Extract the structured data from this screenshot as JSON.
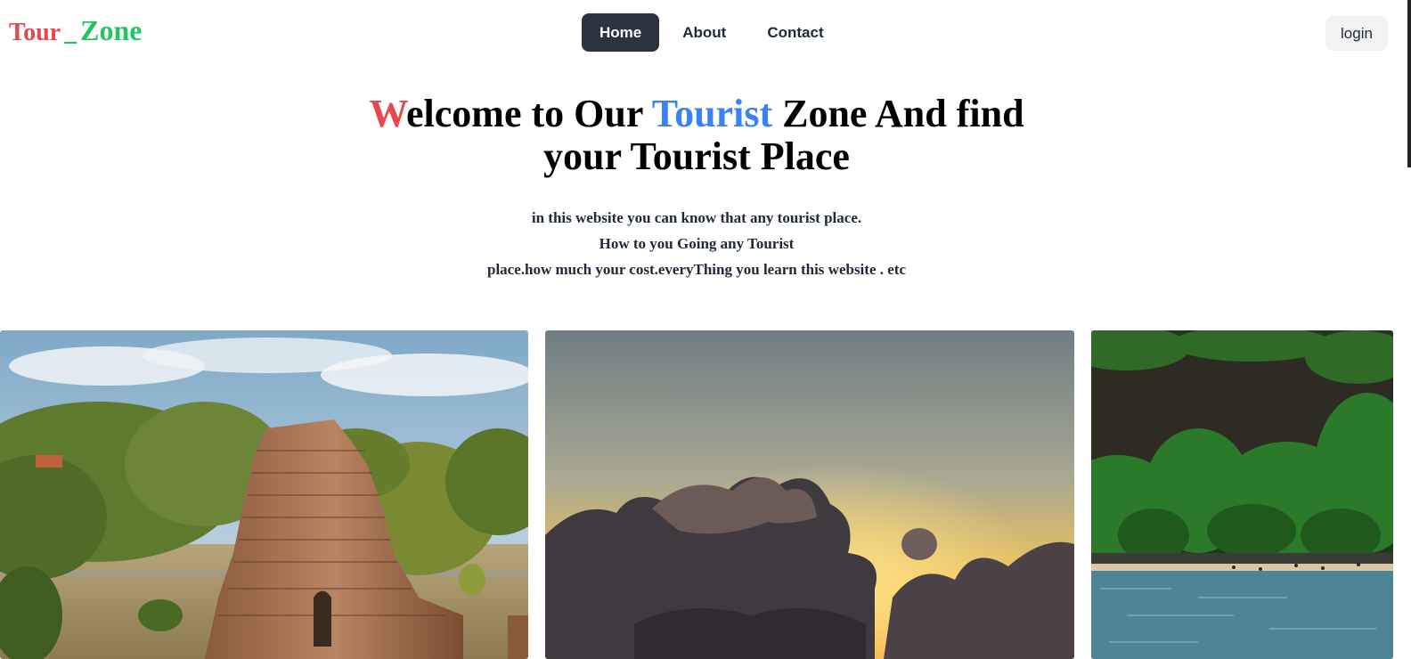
{
  "logo": {
    "part1": "Tour",
    "separator": "_",
    "part2": "Zone"
  },
  "nav": {
    "items": [
      {
        "label": "Home",
        "active": true
      },
      {
        "label": "About",
        "active": false
      },
      {
        "label": "Contact",
        "active": false
      }
    ]
  },
  "login": {
    "label": "login"
  },
  "hero": {
    "title_first_letter": "W",
    "title_part1": "elcome to Our ",
    "title_accent": "Tourist",
    "title_part2": " Zone And find",
    "title_line2": "your Tourist Place",
    "sub_line1": "in this website you can know that any tourist place.",
    "sub_line2": "How to you Going any Tourist",
    "sub_line3": "place.how much your cost.everyThing you learn this website . etc"
  },
  "gallery": {
    "images": [
      {
        "subject": "ancient brick temple with trees"
      },
      {
        "subject": "sunset with clouds"
      },
      {
        "subject": "beach with cliff and forest"
      }
    ]
  },
  "colors": {
    "brand_red": "#e5484d",
    "brand_green": "#22c55e",
    "accent_blue": "#3b82f6",
    "nav_active": "#2b333f"
  }
}
